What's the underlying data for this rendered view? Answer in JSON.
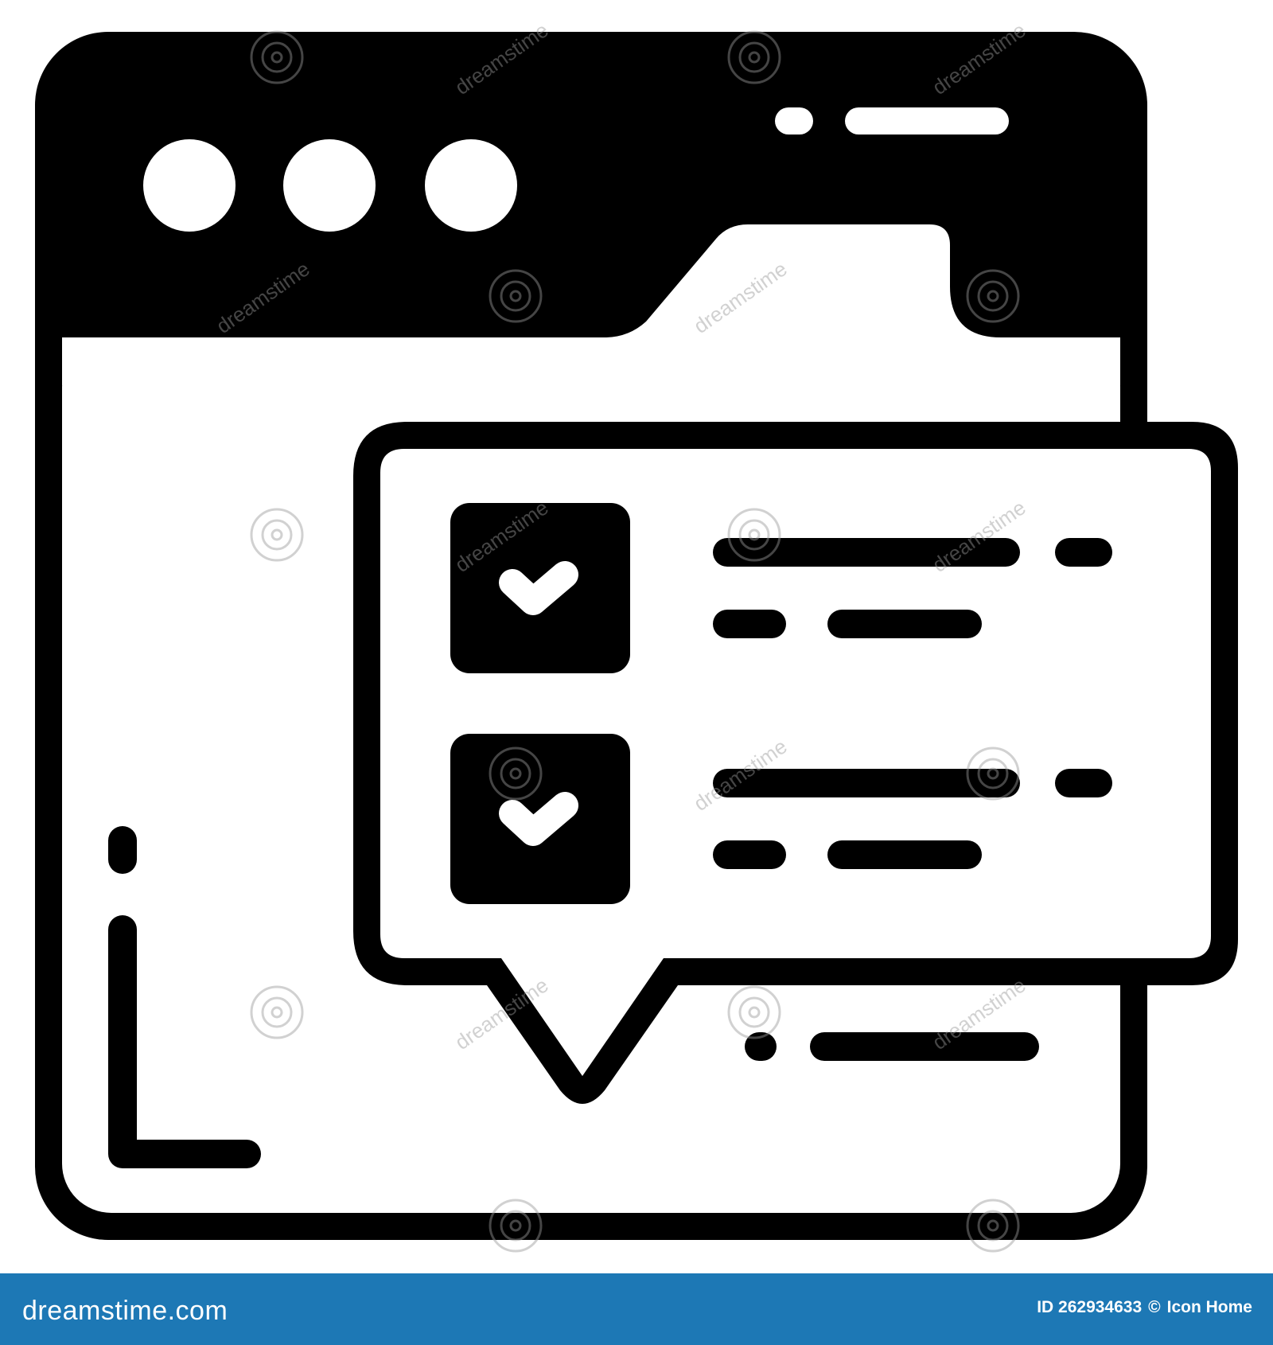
{
  "icon": {
    "name": "browser-folder-checklist-chat-icon",
    "stroke_color": "#000000",
    "fill_color": "#ffffff"
  },
  "watermark": {
    "text": "dreamstime"
  },
  "footer": {
    "background": "#1d78b5",
    "logo_text": "dreamstime.com",
    "image_id": "ID 262934633",
    "copyright_symbol": "©",
    "author": "Icon Home"
  }
}
